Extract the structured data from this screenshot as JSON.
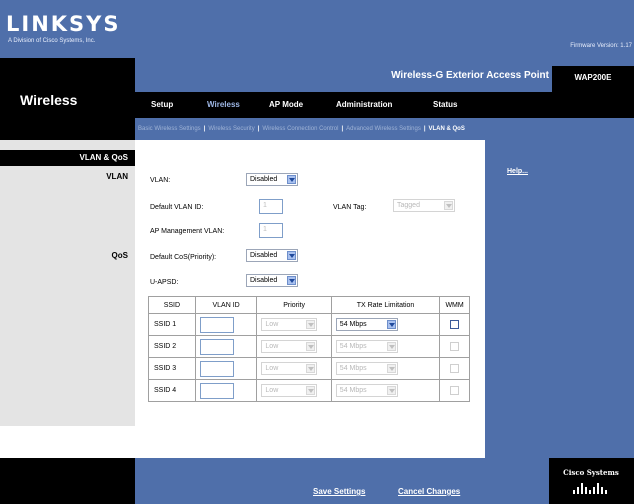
{
  "header": {
    "logo_text": "LINKSYS",
    "logo_sub": "A Division of Cisco Systems, Inc.",
    "firmware": "Firmware Version: 1.17"
  },
  "section": "Wireless",
  "product": {
    "title": "Wireless-G Exterior Access Point",
    "model": "WAP200E"
  },
  "tabs": [
    {
      "label": "Setup"
    },
    {
      "label": "Wireless"
    },
    {
      "label": "AP Mode"
    },
    {
      "label": "Administration"
    },
    {
      "label": "Status"
    }
  ],
  "subtabs": [
    {
      "label": "Basic Wireless Settings"
    },
    {
      "label": "Wireless Security"
    },
    {
      "label": "Wireless Connection Control"
    },
    {
      "label": "Advanced Wireless Settings"
    },
    {
      "label": "VLAN & QoS"
    }
  ],
  "sidebar": {
    "page": "VLAN & QoS",
    "vlan_group": "VLAN",
    "qos_group": "QoS"
  },
  "form": {
    "vlan_label": "VLAN:",
    "vlan_value": "Disabled",
    "default_vlan_id_label": "Default VLAN ID:",
    "default_vlan_id_value": "1",
    "vlan_tag_label": "VLAN Tag:",
    "vlan_tag_value": "Tagged",
    "ap_mgmt_vlan_label": "AP Management VLAN:",
    "ap_mgmt_vlan_value": "1",
    "default_cos_label": "Default CoS(Priority):",
    "default_cos_value": "Disabled",
    "uapsd_label": "U-APSD:",
    "uapsd_value": "Disabled"
  },
  "table": {
    "headers": [
      "SSID",
      "VLAN ID",
      "Priority",
      "TX Rate Limitation",
      "WMM"
    ],
    "rows": [
      {
        "ssid": "SSID 1",
        "priority": "Low",
        "rate": "54 Mbps"
      },
      {
        "ssid": "SSID 2",
        "priority": "Low",
        "rate": "54 Mbps"
      },
      {
        "ssid": "SSID 3",
        "priority": "Low",
        "rate": "54 Mbps"
      },
      {
        "ssid": "SSID 4",
        "priority": "Low",
        "rate": "54 Mbps"
      }
    ]
  },
  "help_link": "Help...",
  "footer": {
    "save": "Save Settings",
    "cancel": "Cancel Changes",
    "cisco": "Cisco Systems"
  },
  "colors": {
    "brand_blue": "#4f6faa",
    "black": "#000000",
    "sidebar_gray": "#e4e4e4"
  }
}
